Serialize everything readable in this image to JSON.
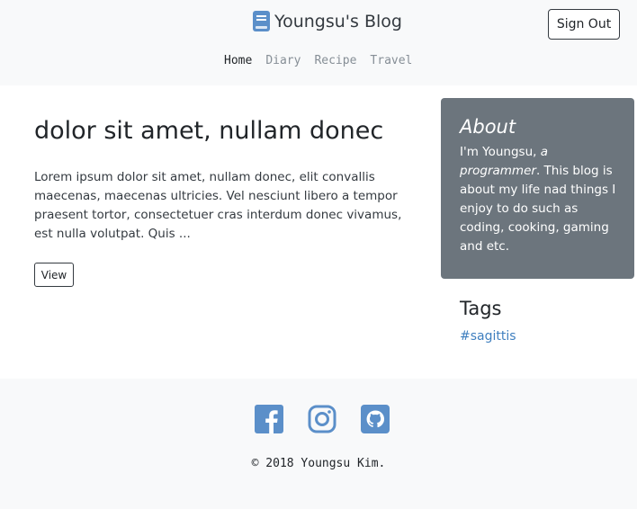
{
  "header": {
    "brand_icon": "book-icon",
    "title": "Youngsu's Blog",
    "sign_out_label": "Sign Out",
    "nav": [
      {
        "label": "Home",
        "active": true
      },
      {
        "label": "Diary",
        "active": false
      },
      {
        "label": "Recipe",
        "active": false
      },
      {
        "label": "Travel",
        "active": false
      }
    ]
  },
  "post": {
    "title": "dolor sit amet, nullam donec",
    "excerpt": "Lorem ipsum dolor sit amet, nullam donec, elit convallis maecenas, maecenas ultricies. Vel nesciunt libero a tempor praesent tortor, consectetuer cras interdum donec vivamus, est nulla volutpat. Quis ...",
    "view_label": "View"
  },
  "sidebar": {
    "about": {
      "title": "About",
      "text_before": "I'm Youngsu, ",
      "text_emphasis": "a programmer",
      "text_after": ". This blog is about my life nad things I enjoy to do such as coding, cooking, gaming and etc."
    },
    "tags": {
      "title": "Tags",
      "items": [
        "#sagittis"
      ]
    }
  },
  "footer": {
    "social": [
      {
        "name": "facebook-icon"
      },
      {
        "name": "instagram-icon"
      },
      {
        "name": "github-icon"
      }
    ],
    "copyright": "© 2018 Youngsu Kim."
  },
  "colors": {
    "header_bg": "#f8f9fa",
    "about_card_bg": "#6c757d",
    "link": "#3f7fbf",
    "social_icon": "#5b8fc9"
  }
}
